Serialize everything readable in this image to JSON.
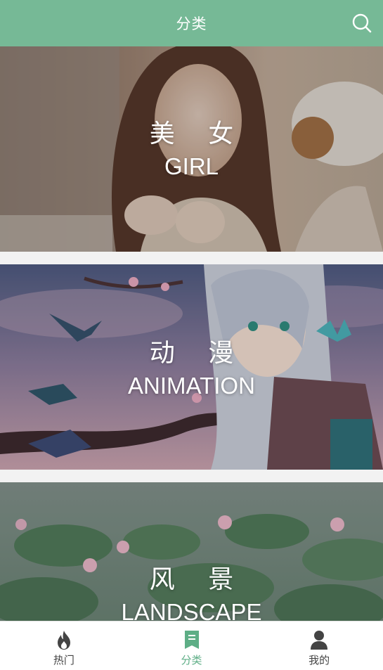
{
  "header": {
    "title": "分类",
    "search_icon": "search-icon"
  },
  "categories": [
    {
      "title_cn": "美 女",
      "title_en": "GIRL",
      "image": "portrait photo of a smiling girl"
    },
    {
      "title_cn": "动 漫",
      "title_en": "ANIMATION",
      "image": "anime girl with birds and butterflies"
    },
    {
      "title_cn": "风 景",
      "title_en": "LANDSCAPE",
      "image": "lotus pond"
    }
  ],
  "tabbar": {
    "active_tab": "分类",
    "accent_color": "#5eae86",
    "items": [
      {
        "label": "热门",
        "icon": "flame-icon"
      },
      {
        "label": "分类",
        "icon": "bookmark-list-icon"
      },
      {
        "label": "我的",
        "icon": "person-icon"
      }
    ]
  },
  "colors": {
    "header_bg": "#76b996",
    "tab_active": "#5eae86",
    "tab_inactive": "#444444",
    "page_bg": "#f2f2f2"
  }
}
